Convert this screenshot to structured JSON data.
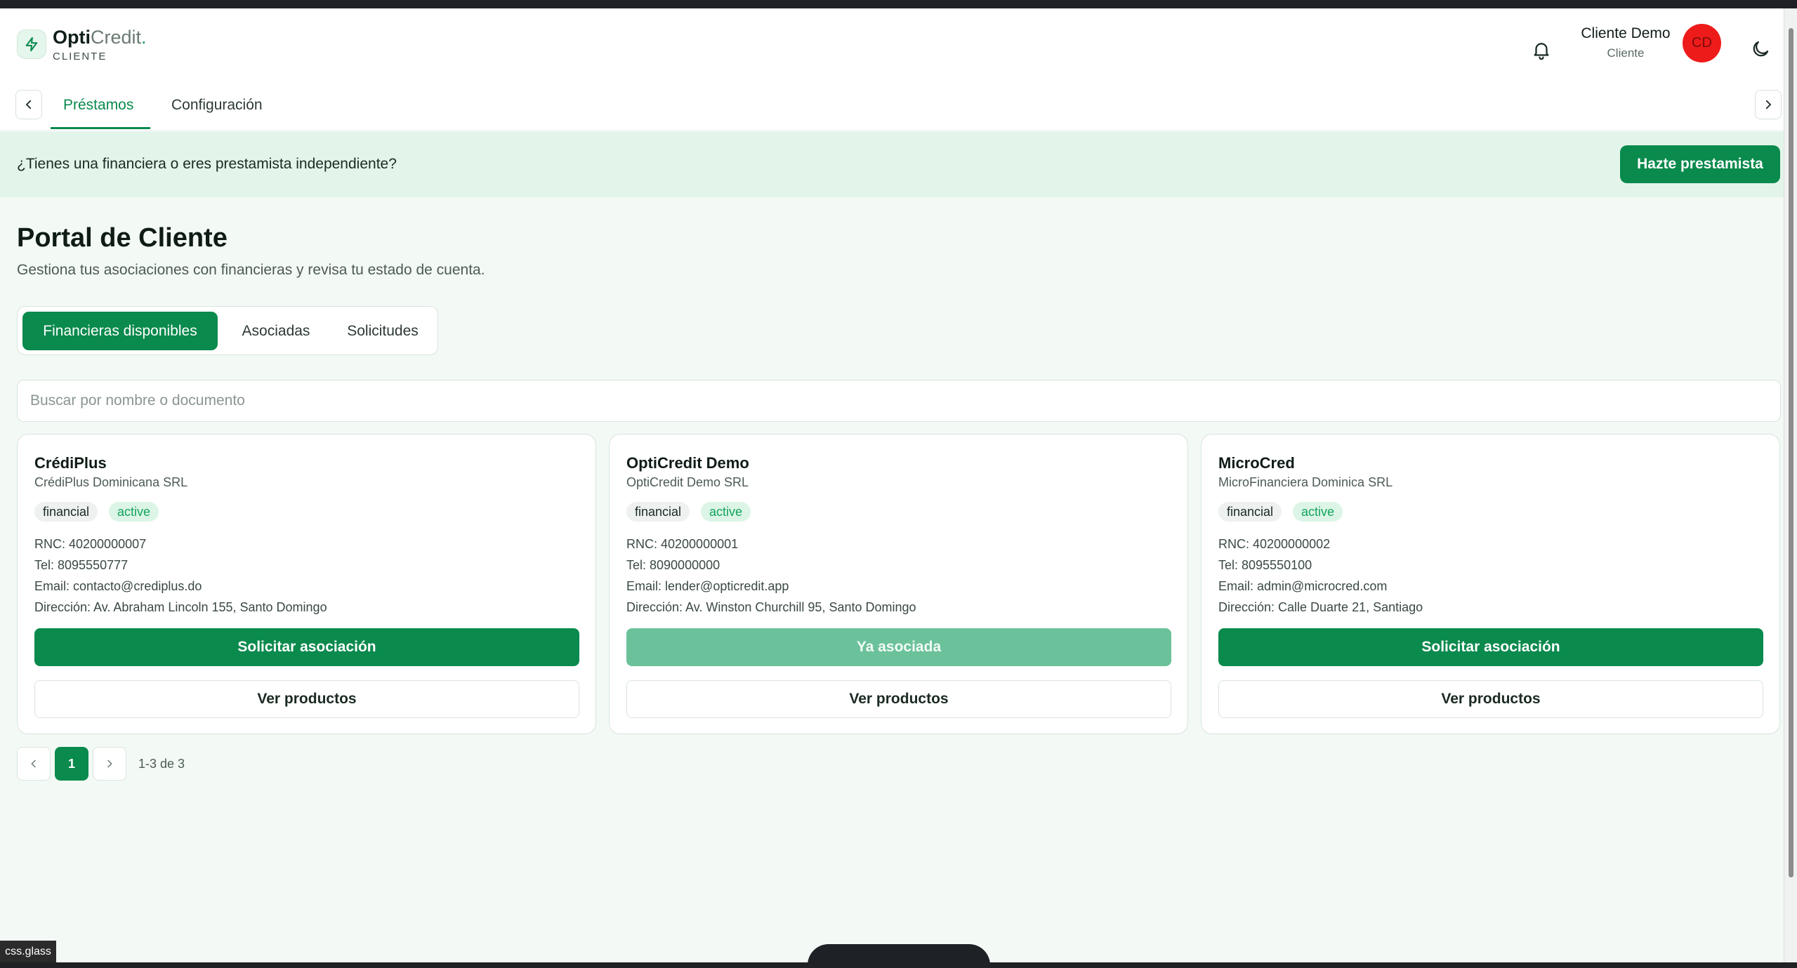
{
  "brand": {
    "name_bold": "Opti",
    "name_light": "Credit",
    "dot": ".",
    "subtitle": "CLIENTE"
  },
  "user": {
    "name": "Cliente Demo",
    "role": "Cliente",
    "initials": "CD"
  },
  "nav": {
    "tabs": [
      {
        "label": "Préstamos",
        "active": true
      },
      {
        "label": "Configuración",
        "active": false
      }
    ]
  },
  "banner": {
    "text": "¿Tienes una financiera o eres prestamista independiente?",
    "button": "Hazte prestamista"
  },
  "page": {
    "title": "Portal de Cliente",
    "subtitle": "Gestiona tus asociaciones con financieras y revisa tu estado de cuenta."
  },
  "segments": [
    {
      "label": "Financieras disponibles",
      "active": true
    },
    {
      "label": "Asociadas",
      "active": false
    },
    {
      "label": "Solicitudes",
      "active": false
    }
  ],
  "search": {
    "placeholder": "Buscar por nombre o documento",
    "value": ""
  },
  "lenders": [
    {
      "name": "CrédiPlus",
      "legal_name": "CrédiPlus Dominicana SRL",
      "type": "financial",
      "status": "active",
      "rnc": "RNC: 40200000007",
      "tel": "Tel: 8095550777",
      "email": "Email: contacto@crediplus.do",
      "address": "Dirección: Av. Abraham Lincoln 155, Santo Domingo",
      "primary_action": "Solicitar asociación",
      "primary_disabled": false,
      "secondary_action": "Ver productos"
    },
    {
      "name": "OptiCredit Demo",
      "legal_name": "OptiCredit Demo SRL",
      "type": "financial",
      "status": "active",
      "rnc": "RNC: 40200000001",
      "tel": "Tel: 8090000000",
      "email": "Email: lender@opticredit.app",
      "address": "Dirección: Av. Winston Churchill 95, Santo Domingo",
      "primary_action": "Ya asociada",
      "primary_disabled": true,
      "secondary_action": "Ver productos"
    },
    {
      "name": "MicroCred",
      "legal_name": "MicroFinanciera Dominica SRL",
      "type": "financial",
      "status": "active",
      "rnc": "RNC: 40200000002",
      "tel": "Tel: 8095550100",
      "email": "Email: admin@microcred.com",
      "address": "Dirección: Calle Duarte 21, Santiago",
      "primary_action": "Solicitar asociación",
      "primary_disabled": false,
      "secondary_action": "Ver productos"
    }
  ],
  "pagination": {
    "current_page": "1",
    "summary": "1-3 de 3"
  },
  "overlay": {
    "label": "css.glass"
  },
  "icons": {
    "logo": "bolt-icon",
    "notifications": "bell-icon",
    "theme": "moon-icon",
    "prev": "chevron-left-icon",
    "next": "chevron-right-icon"
  },
  "colors": {
    "primary": "#0a8a4d",
    "primary_disabled": "#6bc29a",
    "banner_bg": "#e3f5ea",
    "page_bg": "#f3faf5",
    "avatar": "#ee1b1b"
  }
}
